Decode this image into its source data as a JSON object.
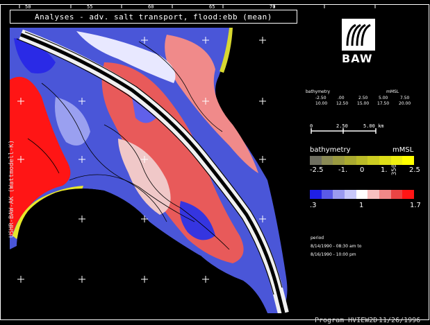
{
  "title": "Analyses - adv. salt transport, flood:ebb (mean)",
  "side_text": "USHR-BAW-AK (Wattmodell-K)",
  "side_text_right": "350",
  "top_ticks": [
    "50",
    "55",
    "60",
    "65",
    "70"
  ],
  "program": "Program  HVIEW2D",
  "date": "11/26/1996",
  "logo_text": "BAW",
  "bathymetry_small": {
    "title": "bathymetry",
    "unit": "mMSL",
    "row1": [
      "-2.50",
      ".00",
      "2.50",
      "5.00",
      "7.50"
    ],
    "row2": [
      "10.00",
      "12.50",
      "15.00",
      "17.50",
      "20.00"
    ]
  },
  "scale_bar": {
    "labels": [
      "0",
      "2.50",
      "5.00 km"
    ]
  },
  "bathymetry_legend": {
    "title": "bathymetry",
    "unit": "mMSL",
    "labels": [
      "-2.5",
      "-1.",
      "0",
      "1.",
      "2.5"
    ],
    "colors": [
      "#6e6e60",
      "#8a8a55",
      "#9a9a40",
      "#aaaa30",
      "#bbbb28",
      "#cccc22",
      "#dddd18",
      "#eeee10",
      "#ffff00"
    ]
  },
  "ratio_legend": {
    "labels": [
      ".3",
      "1",
      "1.7"
    ],
    "colors": [
      "#1f1fe6",
      "#5a5ae8",
      "#9a9af0",
      "#c8c8fa",
      "#ffffff",
      "#f8c0c0",
      "#f08888",
      "#ea4444",
      "#ff1515"
    ]
  },
  "period": {
    "title": "period",
    "line1": "8/14/1990 - 08:30 am to",
    "line2": "8/16/1990 - 10:00 pm"
  }
}
